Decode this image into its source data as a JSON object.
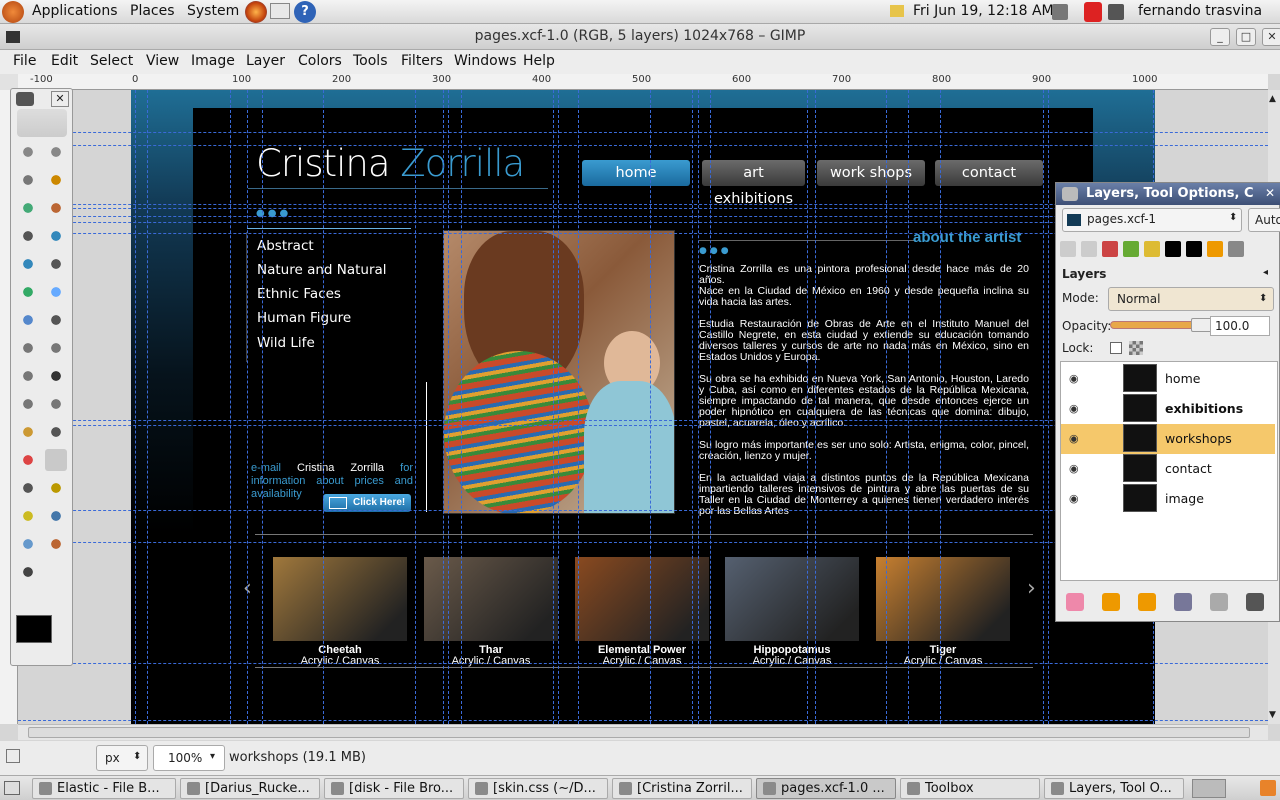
{
  "top_panel": {
    "menus": [
      "Applications",
      "Places",
      "System"
    ],
    "datetime": "Fri Jun 19, 12:18 AM",
    "user": "fernando trasvina"
  },
  "window": {
    "title": "pages.xcf-1.0 (RGB, 5 layers) 1024x768 – GIMP"
  },
  "menubar": [
    "File",
    "Edit",
    "Select",
    "View",
    "Image",
    "Layer",
    "Colors",
    "Tools",
    "Filters",
    "Windows",
    "Help"
  ],
  "ruler_ticks": [
    "-100",
    "0",
    "100",
    "200",
    "300",
    "400",
    "500",
    "600",
    "700",
    "800",
    "900",
    "1000"
  ],
  "website": {
    "name_first": "Cristina",
    "name_last": "Zorrilla",
    "nav": [
      "home",
      "art exhibitions",
      "work shops",
      "contact"
    ],
    "sidebar": [
      "Abstract",
      "Nature and Natural",
      "Ethnic Faces",
      "Human Figure",
      "Wild Life"
    ],
    "email_prefix": "e-mail",
    "email_name": "Cristina Zorrilla",
    "email_suffix": "for information about prices and availability",
    "click_here": "Click Here!",
    "about_title": "about the artist",
    "bio": "Cristina Zorrilla es una pintora profesional desde hace más de 20 años.\nNace en la Ciudad de México en 1960 y desde pequeña inclina su vida hacia las artes.\n\nEstudia Restauración de Obras de Arte en el Instituto Manuel del Castillo Negrete, en esta ciudad y extiende su educación tomando diversos talleres y cursos de arte no nada más en México, sino en Estados Unidos y Europa.\n\nSu obra se ha exhibido en Nueva York, San Antonio, Houston, Laredo y Cuba, así como en diferentes estados de la República Mexicana, siempre impactando de tal manera, que desde entonces ejerce un poder hipnótico en cualquiera de las técnicas que domina: dibujo, pastel, acuarela, óleo y acrílico.\n\nSu logro más importante es ser uno solo: Artista, enigma, color, pincel, creación, lienzo y mujer.\n\nEn la actualidad viaja a distintos puntos de la República Mexicana impartiendo talleres intensivos de pintura y abre las puertas de su Taller en la Ciudad de Monterrey a quienes tienen verdadero interés por las Bellas Artes",
    "gallery": [
      {
        "title": "Cheetah",
        "medium": "Acrylic / Canvas",
        "color": "#a0783c"
      },
      {
        "title": "Thar",
        "medium": "Acrylic / Canvas",
        "color": "#6a5a4a"
      },
      {
        "title": "Elemental Power",
        "medium": "Acrylic / Canvas",
        "color": "#8a4a20"
      },
      {
        "title": "Hippopotamus",
        "medium": "Acrylic / Canvas",
        "color": "#556070"
      },
      {
        "title": "Tiger",
        "medium": "Acrylic / Canvas",
        "color": "#c88030"
      }
    ]
  },
  "layers_dialog": {
    "title": "Layers, Tool Options, C",
    "image_select": "pages.xcf-1",
    "auto_label": "Auto",
    "section": "Layers",
    "mode_label": "Mode:",
    "mode_value": "Normal",
    "opacity_label": "Opacity:",
    "opacity_value": "100.0",
    "lock_label": "Lock:",
    "layers": [
      {
        "name": "home",
        "bold": false,
        "selected": false
      },
      {
        "name": "exhibitions",
        "bold": true,
        "selected": false
      },
      {
        "name": "workshops",
        "bold": false,
        "selected": true
      },
      {
        "name": "contact",
        "bold": false,
        "selected": false
      },
      {
        "name": "image",
        "bold": false,
        "selected": false
      }
    ]
  },
  "status": {
    "unit": "px",
    "zoom": "100%",
    "info": "workshops (19.1 MB)"
  },
  "taskbar": [
    "Elastic - File B...",
    "[Darius_Rucke...",
    "[disk - File Bro...",
    "[skin.css (~/D...",
    "[Cristina Zorril...",
    "pages.xcf-1.0 ...",
    "Toolbox",
    "Layers, Tool O..."
  ],
  "colors": {
    "accent": "#3a9bd0",
    "selected_row": "#f5c86b",
    "guide": "#3a6ad8"
  }
}
